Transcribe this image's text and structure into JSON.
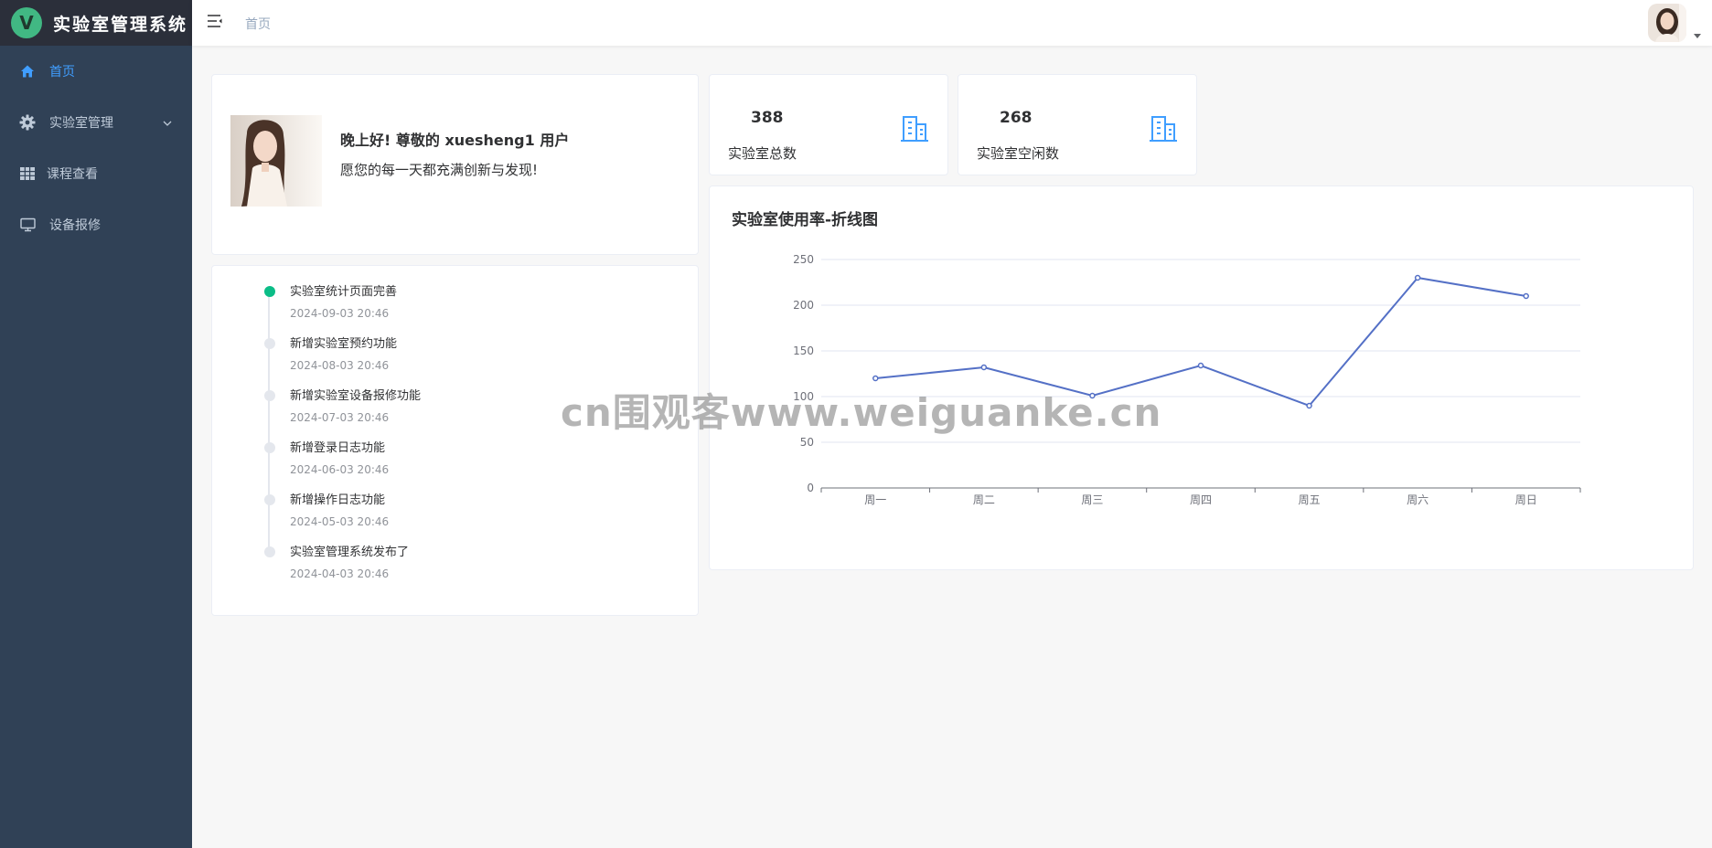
{
  "brand": {
    "logo_letter": "V",
    "title": "实验室管理系统"
  },
  "sidebar": {
    "items": [
      {
        "label": "首页",
        "icon": "home-icon",
        "active": true
      },
      {
        "label": "实验室管理",
        "icon": "gear-icon",
        "has_submenu": true
      },
      {
        "label": "课程查看",
        "icon": "grid-icon"
      },
      {
        "label": "设备报修",
        "icon": "monitor-icon"
      }
    ]
  },
  "header": {
    "breadcrumb": "首页"
  },
  "welcome": {
    "greeting": "晚上好! 尊敬的 xuesheng1 用户",
    "wish": "愿您的每一天都充满创新与发现!"
  },
  "stats": [
    {
      "value": "388",
      "label": "实验室总数",
      "icon": "building-icon"
    },
    {
      "value": "268",
      "label": "实验室空闲数",
      "icon": "building-icon"
    }
  ],
  "timeline": [
    {
      "content": "实验室统计页面完善",
      "time": "2024-09-03 20:46"
    },
    {
      "content": "新增实验室预约功能",
      "time": "2024-08-03 20:46"
    },
    {
      "content": "新增实验室设备报修功能",
      "time": "2024-07-03 20:46"
    },
    {
      "content": "新增登录日志功能",
      "time": "2024-06-03 20:46"
    },
    {
      "content": "新增操作日志功能",
      "time": "2024-05-03 20:46"
    },
    {
      "content": "实验室管理系统发布了",
      "time": "2024-04-03 20:46"
    }
  ],
  "chart_data": {
    "type": "line",
    "title": "实验室使用率-折线图",
    "categories": [
      "周一",
      "周二",
      "周三",
      "周四",
      "周五",
      "周六",
      "周日"
    ],
    "series": [
      {
        "values": [
          120,
          132,
          101,
          134,
          90,
          230,
          210
        ]
      }
    ],
    "ylim": [
      0,
      250
    ],
    "yticks": [
      0,
      50,
      100,
      150,
      200,
      250
    ],
    "grid": true,
    "colors": {
      "line": "#5470c6",
      "grid": "#e0e6f1",
      "axis": "#6e7079"
    }
  },
  "watermark": "cn围观客www.weiguanke.cn",
  "colors": {
    "sidebar_bg": "#304156",
    "brand_bg": "#2b2f3a",
    "accent": "#409eff",
    "timeline_first": "#0bbd87"
  }
}
